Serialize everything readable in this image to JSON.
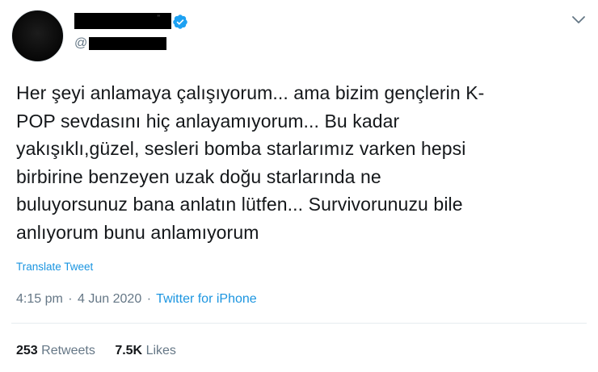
{
  "user": {
    "handle_prefix": "@",
    "verified_icon": "verified-badge-icon"
  },
  "tweet": {
    "lines": [
      "Her şeyi anlamaya çalışıyorum... ama bizim gençlerin K-",
      "POP sevdasını hiç anlayamıyorum... Bu kadar",
      "yakışıklı,güzel, sesleri bomba starlarımız varken hepsi",
      "birbirine benzeyen uzak doğu starlarında ne",
      "buluyorsunuz bana anlatın lütfen... Survivorunuzu bile",
      "anlıyorum bunu anlamıyorum"
    ],
    "translate_label": "Translate Tweet"
  },
  "meta": {
    "time": "4:15 pm",
    "separator": "·",
    "date": "4 Jun 2020",
    "source": "Twitter for iPhone"
  },
  "stats": {
    "retweets_count": "253",
    "retweets_label": "Retweets",
    "likes_count": "7.5K",
    "likes_label": "Likes"
  },
  "colors": {
    "link": "#1b95e0",
    "muted": "#657786",
    "text": "#14171a",
    "verified": "#1da1f2"
  }
}
